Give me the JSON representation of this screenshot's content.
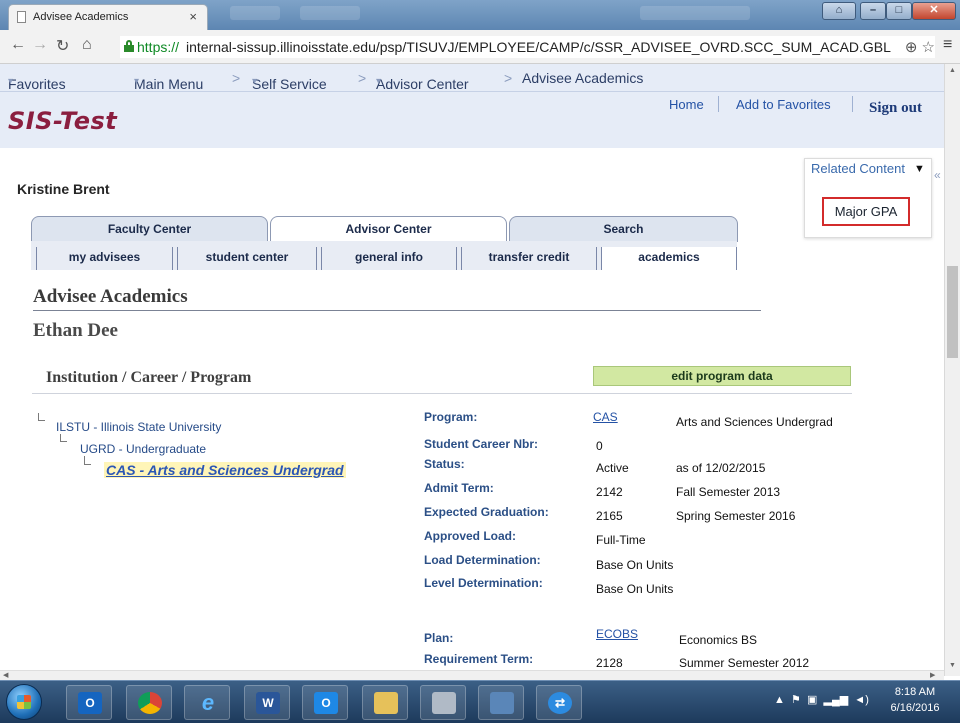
{
  "browser": {
    "tab_title": "Advisee Academics",
    "url_scheme": "https://",
    "url_rest": "internal-sissup.illinoisstate.edu/psp/TISUVJ/EMPLOYEE/CAMP/c/SSR_ADVISEE_OVRD.SCC_SUM_ACAD.GBL"
  },
  "nav": {
    "favorites": "Favorites",
    "main_menu": "Main Menu",
    "self_service": "Self Service",
    "advisor_center": "Advisor Center",
    "current": "Advisee Academics",
    "sep": ">",
    "caret": "▾"
  },
  "header": {
    "logo": "SIS-Test",
    "home": "Home",
    "add_favorites": "Add to Favorites",
    "sign_out": "Sign out"
  },
  "related_content": {
    "label": "Related Content",
    "items": [
      "Major GPA"
    ]
  },
  "advisor_name": "Kristine Brent",
  "tabs_level1": [
    "Faculty Center",
    "Advisor Center",
    "Search"
  ],
  "tabs_level2": [
    "my advisees",
    "student center",
    "general info",
    "transfer credit",
    "academics"
  ],
  "page_title": "Advisee Academics",
  "advisee_name": "Ethan Dee",
  "section": {
    "title": "Institution / Career / Program",
    "edit_button": "edit program data"
  },
  "tree": {
    "institution": "ILSTU - Illinois State University",
    "career": "UGRD - Undergraduate",
    "program": "CAS - Arts and Sciences Undergrad"
  },
  "details": {
    "program_label": "Program:",
    "program_code": "CAS",
    "program_desc": "Arts and Sciences Undergrad",
    "career_nbr_label": "Student Career Nbr:",
    "career_nbr": "0",
    "status_label": "Status:",
    "status": "Active",
    "status_date": "as of 12/02/2015",
    "admit_label": "Admit Term:",
    "admit_code": "2142",
    "admit_desc": "Fall Semester 2013",
    "grad_label": "Expected Graduation:",
    "grad_code": "2165",
    "grad_desc": "Spring Semester 2016",
    "load_label": "Approved Load:",
    "load": "Full-Time",
    "load_det_label": "Load Determination:",
    "load_det": "Base On Units",
    "level_det_label": "Level Determination:",
    "level_det": "Base On Units",
    "plan_label": "Plan:",
    "plan_code": "ECOBS",
    "plan_desc": "Economics BS",
    "req_term_label": "Requirement Term:",
    "req_term_code": "2128",
    "req_term_desc": "Summer Semester 2012"
  },
  "taskbar": {
    "time": "8:18 AM",
    "date": "6/16/2016",
    "apps": [
      "outlook",
      "chrome",
      "internet-explorer",
      "word",
      "outlook-alt",
      "file-explorer",
      "calculator",
      "notepad",
      "teamviewer"
    ]
  }
}
